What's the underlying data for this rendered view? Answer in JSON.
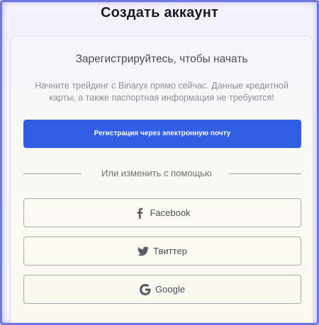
{
  "page": {
    "title": "Создать аккаунт"
  },
  "card": {
    "subtitle": "Зарегистрируйтесь, чтобы начать",
    "description": "Начните трейдинг с Binaryx прямо сейчас. Данные кредитной карты, а также паспортная информация не требуются!",
    "email_button_label": "Регистрация через электронную почту",
    "divider_text": "Или изменить с помощью",
    "social_buttons": [
      {
        "label": "Facebook",
        "icon": "facebook-icon"
      },
      {
        "label": "Твиттер",
        "icon": "twitter-icon"
      },
      {
        "label": "Google",
        "icon": "google-icon"
      }
    ]
  },
  "colors": {
    "accent": "#2f5fe0",
    "frame_border": "#6f74e6",
    "text_dark": "#1b1b24",
    "text_muted": "#8e8e97",
    "icon_gray": "#5a5a64"
  }
}
